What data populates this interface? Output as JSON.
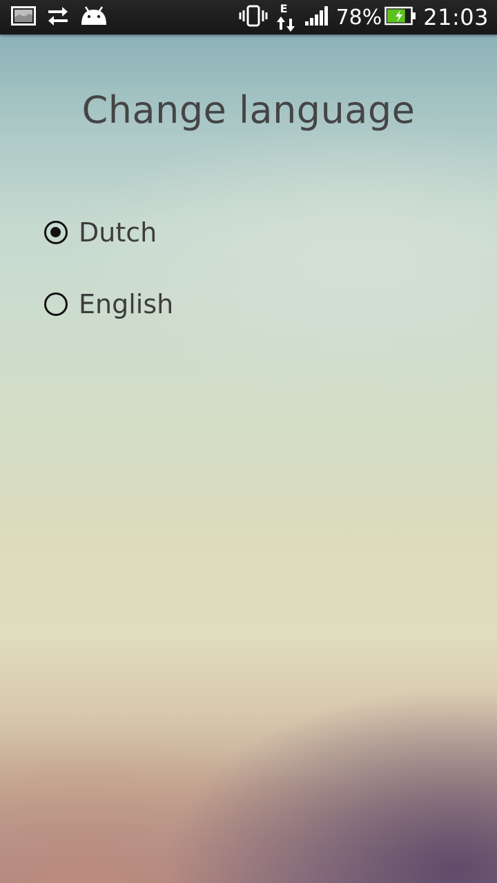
{
  "status_bar": {
    "icons_left": [
      "gallery-notification-icon",
      "sync-arrows-icon",
      "android-icon"
    ],
    "icons_right": [
      "vibrate-icon",
      "data-e-icon",
      "signal-icon",
      "battery-charging-icon"
    ],
    "network_type": "E",
    "battery_percent": "78%",
    "time": "21:03",
    "battery_level": 0.78,
    "battery_color": "#5cc21d"
  },
  "screen": {
    "title": "Change language",
    "options": [
      {
        "label": "Dutch",
        "selected": true
      },
      {
        "label": "English",
        "selected": false
      }
    ]
  }
}
